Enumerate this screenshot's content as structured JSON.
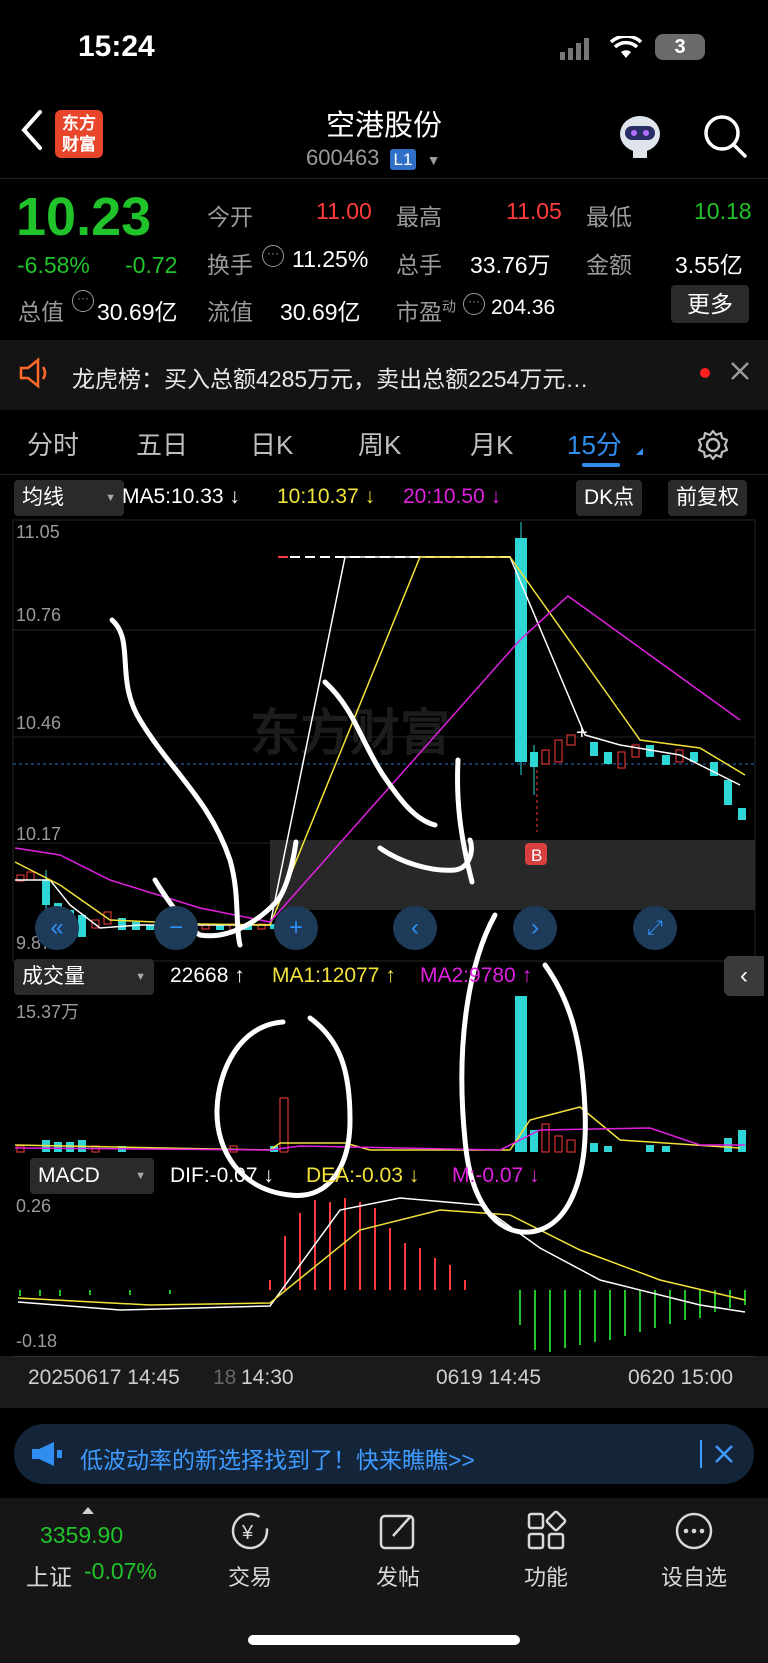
{
  "status_bar": {
    "time": "15:24",
    "battery": "3"
  },
  "header": {
    "title": "空港股份",
    "code": "600463",
    "level": "L1",
    "logo_line1": "东方",
    "logo_line2": "财富"
  },
  "quote": {
    "price": "10.23",
    "change_pct": "-6.58%",
    "change": "-0.72",
    "open_label": "今开",
    "open": "11.00",
    "high_label": "最高",
    "high": "11.05",
    "low_label": "最低",
    "low": "10.18",
    "turnover_label": "换手",
    "turnover": "11.25%",
    "volume_label": "总手",
    "volume": "33.76万",
    "amount_label": "金额",
    "amount": "3.55亿",
    "total_cap_label": "总值",
    "total_cap": "30.69亿",
    "float_cap_label": "流值",
    "float_cap": "30.69亿",
    "pe_label": "市盈",
    "pe_sup": "动",
    "pe": "204.36",
    "more": "更多"
  },
  "news": {
    "text": "龙虎榜：买入总额4285万元，卖出总额2254万元…"
  },
  "tabs": [
    "分时",
    "五日",
    "日K",
    "周K",
    "月K",
    "15分"
  ],
  "chart_controls": {
    "ma_selector": "均线",
    "ma5": "MA5:10.33",
    "ma10": "10:10.37",
    "ma20": "20:10.50",
    "dk": "DK点",
    "fq": "前复权",
    "b_marker": "B"
  },
  "volume_panel": {
    "selector": "成交量",
    "value": "22668",
    "ma1": "MA1:12077",
    "ma2": "MA2:9780",
    "y_top": "15.37万"
  },
  "macd_panel": {
    "selector": "MACD",
    "dif": "DIF:-0.07",
    "dea": "DEA:-0.03",
    "m": "M:-0.07",
    "y_top": "0.26",
    "y_bottom": "-0.18"
  },
  "time_axis": {
    "t1": "20250617 14:45",
    "t2": "18",
    "t3": "14:30",
    "t4": "0619 14:45",
    "t5": "0620 15:00"
  },
  "price_axis": {
    "p1": "11.05",
    "p2": "10.76",
    "p3": "10.46",
    "p4": "10.17",
    "p5": "9.87"
  },
  "banner": {
    "text": "低波动率的新选择找到了！快来瞧瞧>>"
  },
  "bottom_bar": {
    "index_value": "3359.90",
    "index_name": "上证",
    "index_change": "-0.07%",
    "trade": "交易",
    "post": "发帖",
    "functions": "功能",
    "watchlist": "设自选"
  },
  "colors": {
    "up": "#ff3b3b",
    "down": "#21c32a",
    "cyan": "#2fd6d6",
    "accent": "#2f8ef0"
  }
}
